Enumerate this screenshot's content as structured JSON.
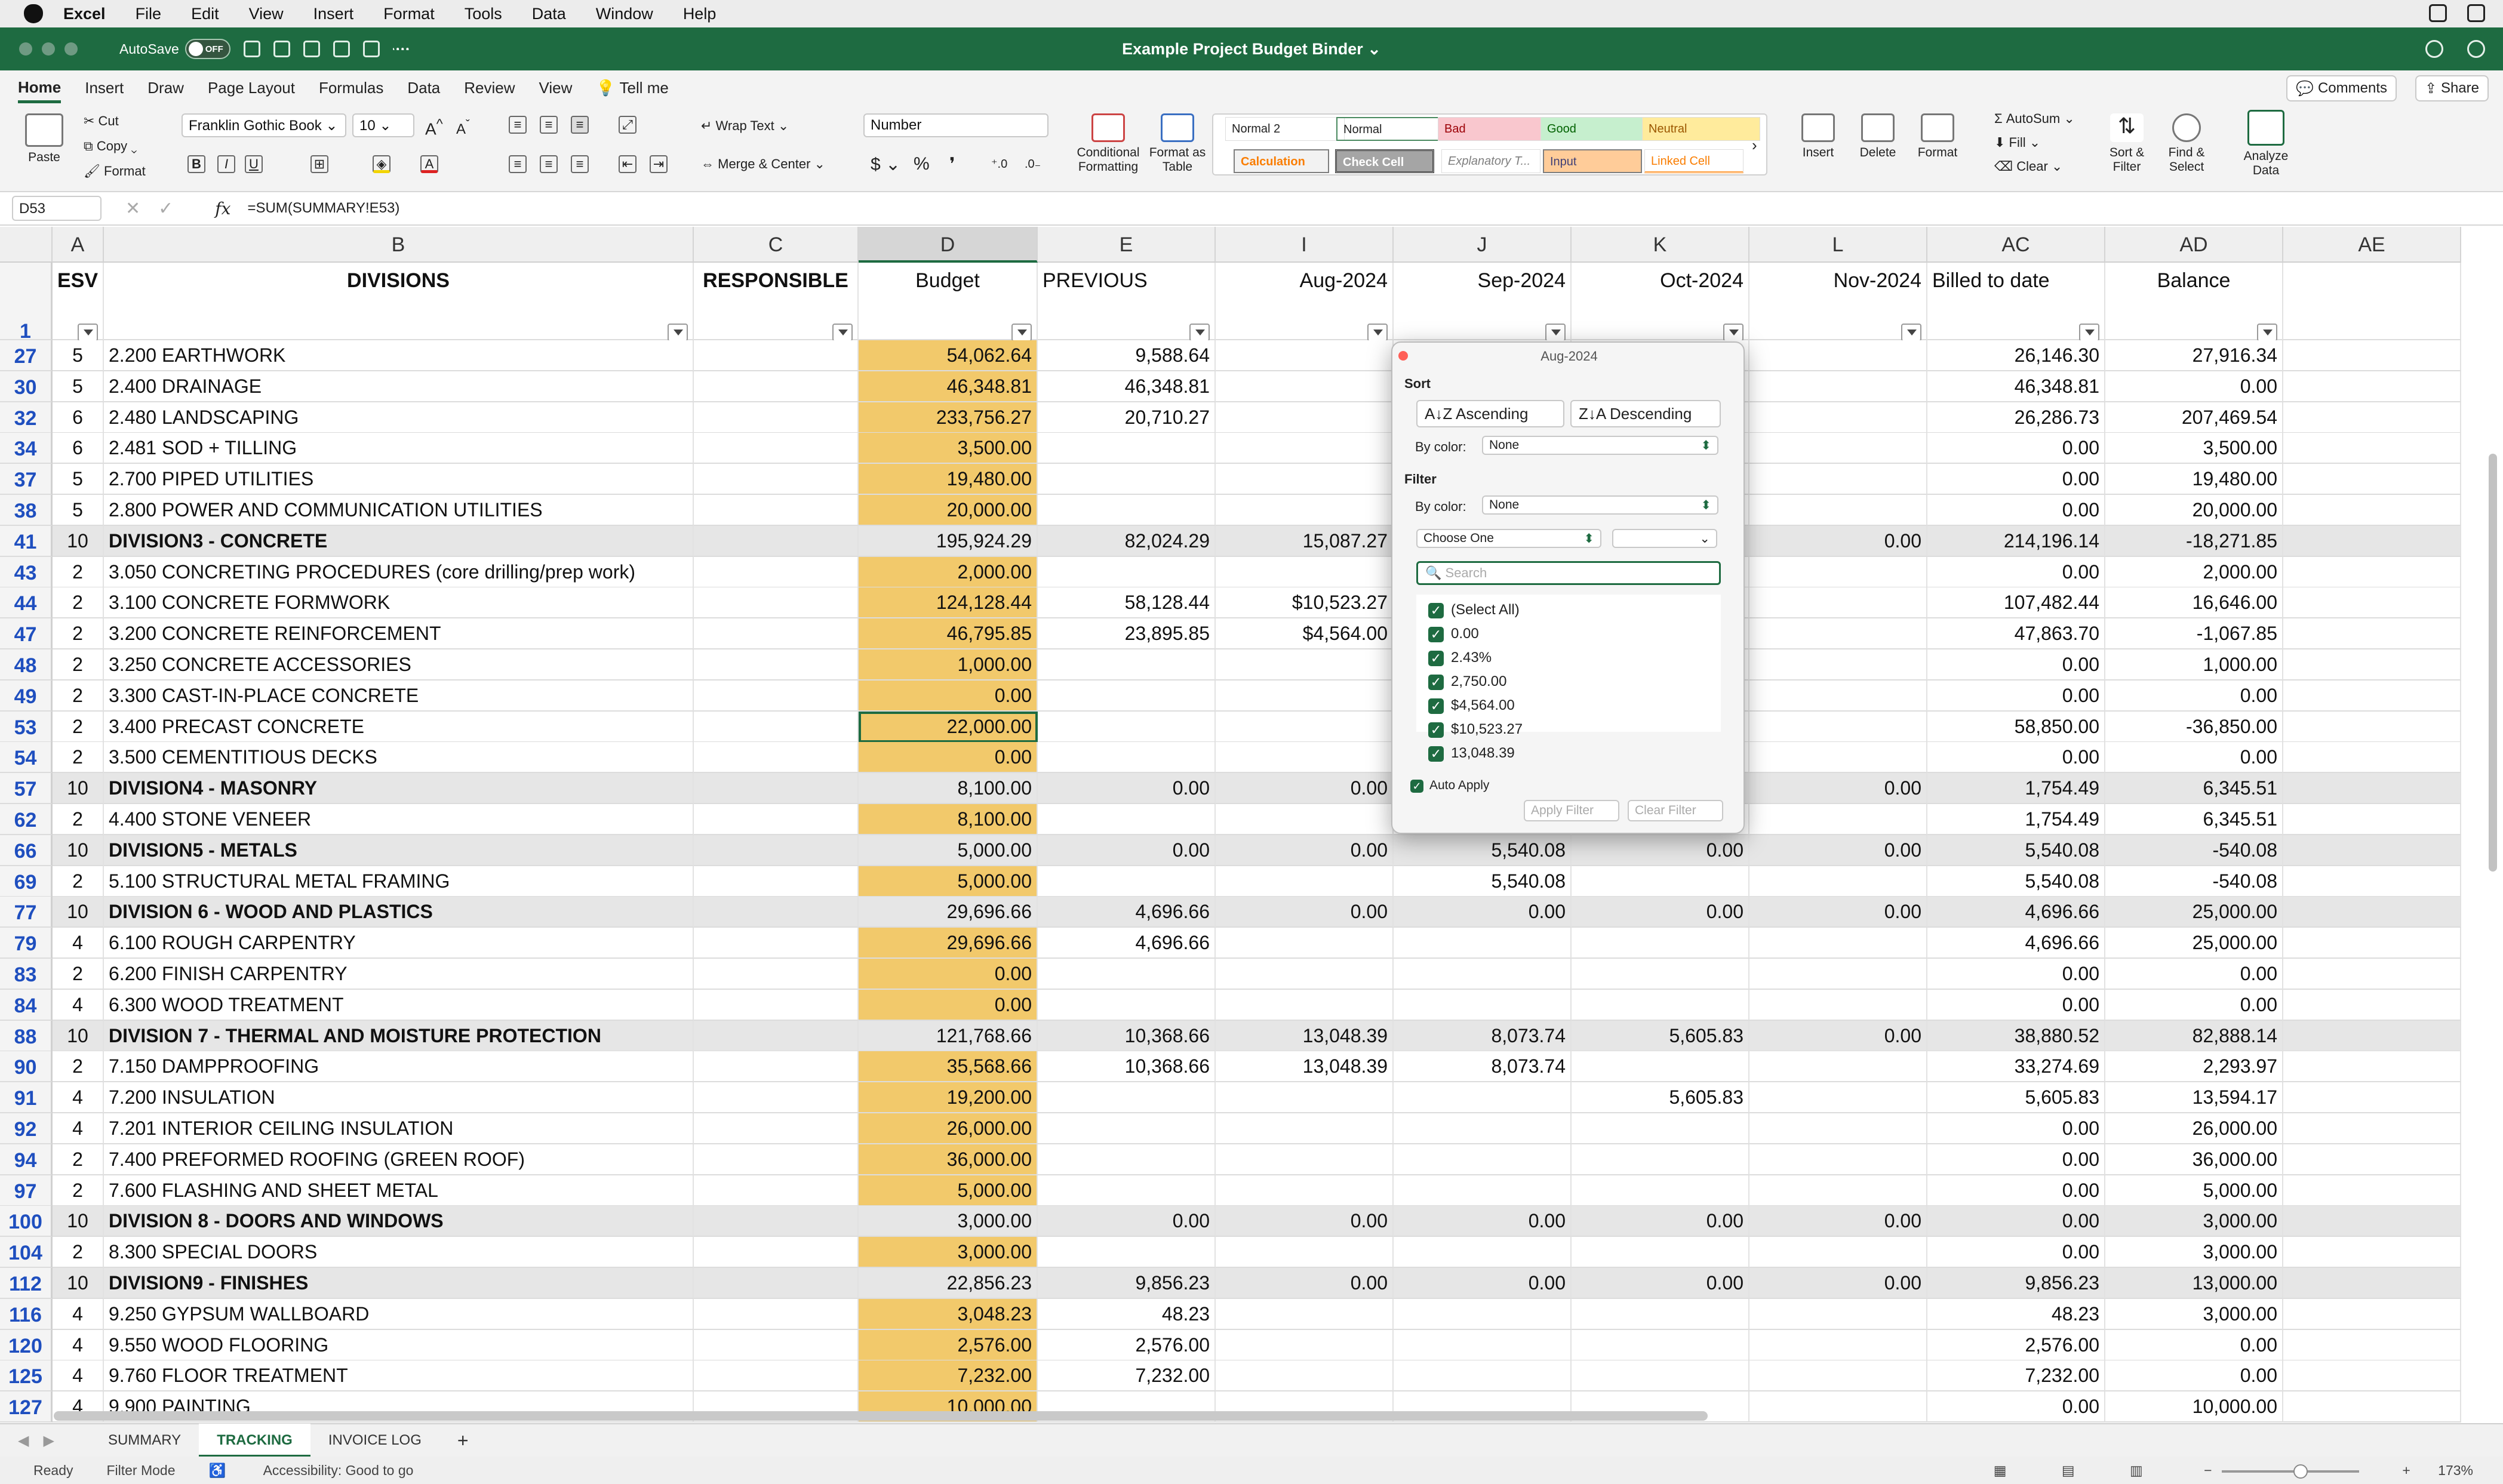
{
  "mac_menu": {
    "app": "Excel",
    "items": [
      "File",
      "Edit",
      "View",
      "Insert",
      "Format",
      "Tools",
      "Data",
      "Window",
      "Help"
    ]
  },
  "titlebar": {
    "autosave": "AutoSave",
    "toggle": "OFF",
    "title": "Example Project Budget Binder"
  },
  "tabs": [
    "Home",
    "Insert",
    "Draw",
    "Page Layout",
    "Formulas",
    "Data",
    "Review",
    "View",
    "Tell me"
  ],
  "buttons": {
    "comments": "Comments",
    "share": "Share"
  },
  "ribbon": {
    "paste": "Paste",
    "cut": "Cut",
    "copy": "Copy",
    "format": "Format",
    "font_name": "Franklin Gothic Book",
    "font_size": "10",
    "wrap_text": "Wrap Text",
    "merge_center": "Merge & Center",
    "number_format": "Number",
    "conditional_formatting": "Conditional Formatting",
    "format_as_table": "Format as Table",
    "styles": [
      "Normal 2",
      "Normal",
      "Bad",
      "Good",
      "Neutral",
      "Calculation",
      "Check Cell",
      "Explanatory T...",
      "Input",
      "Linked Cell"
    ],
    "insert": "Insert",
    "delete": "Delete",
    "format_cells": "Format",
    "autosum": "AutoSum",
    "fill": "Fill",
    "clear": "Clear",
    "sort_filter": "Sort & Filter",
    "find_select": "Find & Select",
    "analyze_data": "Analyze Data"
  },
  "formula_bar": {
    "name_box": "D53",
    "fx": "fx",
    "formula": "=SUM(SUMMARY!E53)"
  },
  "columns": [
    "A",
    "B",
    "C",
    "D",
    "E",
    "I",
    "J",
    "K",
    "L",
    "AC",
    "AD",
    "AE"
  ],
  "header_row": {
    "row": "1",
    "cells": [
      "ESV",
      "DIVISIONS",
      "RESPONSIBLE",
      "Budget",
      "PREVIOUS",
      "Aug-2024",
      "Sep-2024",
      "Oct-2024",
      "Nov-2024",
      "Billed to date",
      "Balance",
      ""
    ]
  },
  "rows": [
    {
      "r": "27",
      "a": "5",
      "b": "2.200 EARTHWORK",
      "d": "54,062.64",
      "e": "9,588.64",
      "i": "",
      "j": "",
      "k": "",
      "l": "",
      "ac": "26,146.30",
      "ad": "27,916.34",
      "div": false
    },
    {
      "r": "30",
      "a": "5",
      "b": "2.400 DRAINAGE",
      "d": "46,348.81",
      "e": "46,348.81",
      "i": "",
      "j": "",
      "k": "",
      "l": "",
      "ac": "46,348.81",
      "ad": "0.00",
      "div": false
    },
    {
      "r": "32",
      "a": "6",
      "b": "2.480 LANDSCAPING",
      "d": "233,756.27",
      "e": "20,710.27",
      "i": "",
      "j": "",
      "k": "",
      "l": "",
      "ac": "26,286.73",
      "ad": "207,469.54",
      "div": false
    },
    {
      "r": "34",
      "a": "6",
      "b": "2.481 SOD + TILLING",
      "d": "3,500.00",
      "e": "",
      "i": "",
      "j": "",
      "k": "",
      "l": "",
      "ac": "0.00",
      "ad": "3,500.00",
      "div": false
    },
    {
      "r": "37",
      "a": "5",
      "b": "2.700 PIPED UTILITIES",
      "d": "19,480.00",
      "e": "",
      "i": "",
      "j": "",
      "k": "",
      "l": "",
      "ac": "0.00",
      "ad": "19,480.00",
      "div": false
    },
    {
      "r": "38",
      "a": "5",
      "b": "2.800 POWER AND COMMUNICATION UTILITIES",
      "d": "20,000.00",
      "e": "",
      "i": "",
      "j": "",
      "k": "",
      "l": "",
      "ac": "0.00",
      "ad": "20,000.00",
      "div": false
    },
    {
      "r": "41",
      "a": "10",
      "b": "DIVISION3 - CONCRETE",
      "d": "195,924.29",
      "e": "82,024.29",
      "i": "15,087.27",
      "j": "",
      "k": "",
      "l": "0.00",
      "ac": "214,196.14",
      "ad": "-18,271.85",
      "div": true
    },
    {
      "r": "43",
      "a": "2",
      "b": "3.050 CONCRETING PROCEDURES (core drilling/prep work)",
      "d": "2,000.00",
      "e": "",
      "i": "",
      "j": "",
      "k": "",
      "l": "",
      "ac": "0.00",
      "ad": "2,000.00",
      "div": false
    },
    {
      "r": "44",
      "a": "2",
      "b": "3.100 CONCRETE FORMWORK",
      "d": "124,128.44",
      "e": "58,128.44",
      "i": "$10,523.27",
      "j": "",
      "k": "",
      "l": "",
      "ac": "107,482.44",
      "ad": "16,646.00",
      "div": false
    },
    {
      "r": "47",
      "a": "2",
      "b": "3.200 CONCRETE REINFORCEMENT",
      "d": "46,795.85",
      "e": "23,895.85",
      "i": "$4,564.00",
      "j": "",
      "k": "",
      "l": "",
      "ac": "47,863.70",
      "ad": "-1,067.85",
      "div": false
    },
    {
      "r": "48",
      "a": "2",
      "b": "3.250 CONCRETE ACCESSORIES",
      "d": "1,000.00",
      "e": "",
      "i": "",
      "j": "",
      "k": "",
      "l": "",
      "ac": "0.00",
      "ad": "1,000.00",
      "div": false
    },
    {
      "r": "49",
      "a": "2",
      "b": "3.300 CAST-IN-PLACE CONCRETE",
      "d": "0.00",
      "e": "",
      "i": "",
      "j": "",
      "k": "",
      "l": "",
      "ac": "0.00",
      "ad": "0.00",
      "div": false
    },
    {
      "r": "53",
      "a": "2",
      "b": "3.400 PRECAST CONCRETE",
      "d": "22,000.00",
      "e": "",
      "i": "",
      "j": "",
      "k": "",
      "l": "",
      "ac": "58,850.00",
      "ad": "-36,850.00",
      "div": false,
      "active": true
    },
    {
      "r": "54",
      "a": "2",
      "b": "3.500 CEMENTITIOUS DECKS",
      "d": "0.00",
      "e": "",
      "i": "",
      "j": "",
      "k": "",
      "l": "",
      "ac": "0.00",
      "ad": "0.00",
      "div": false
    },
    {
      "r": "57",
      "a": "10",
      "b": "DIVISION4 - MASONRY",
      "d": "8,100.00",
      "e": "0.00",
      "i": "0.00",
      "j": "",
      "k": "",
      "l": "0.00",
      "ac": "1,754.49",
      "ad": "6,345.51",
      "div": true
    },
    {
      "r": "62",
      "a": "2",
      "b": "4.400 STONE VENEER",
      "d": "8,100.00",
      "e": "",
      "i": "",
      "j": "",
      "k": "",
      "l": "",
      "ac": "1,754.49",
      "ad": "6,345.51",
      "div": false
    },
    {
      "r": "66",
      "a": "10",
      "b": "DIVISION5 - METALS",
      "d": "5,000.00",
      "e": "0.00",
      "i": "0.00",
      "j": "5,540.08",
      "k": "0.00",
      "l": "0.00",
      "ac": "5,540.08",
      "ad": "-540.08",
      "div": true
    },
    {
      "r": "69",
      "a": "2",
      "b": "5.100 STRUCTURAL METAL FRAMING",
      "d": "5,000.00",
      "e": "",
      "i": "",
      "j": "5,540.08",
      "k": "",
      "l": "",
      "ac": "5,540.08",
      "ad": "-540.08",
      "div": false
    },
    {
      "r": "77",
      "a": "10",
      "b": "DIVISION 6 - WOOD AND PLASTICS",
      "d": "29,696.66",
      "e": "4,696.66",
      "i": "0.00",
      "j": "0.00",
      "k": "0.00",
      "l": "0.00",
      "ac": "4,696.66",
      "ad": "25,000.00",
      "div": true
    },
    {
      "r": "79",
      "a": "4",
      "b": "6.100 ROUGH CARPENTRY",
      "d": "29,696.66",
      "e": "4,696.66",
      "i": "",
      "j": "",
      "k": "",
      "l": "",
      "ac": "4,696.66",
      "ad": "25,000.00",
      "div": false
    },
    {
      "r": "83",
      "a": "2",
      "b": "6.200 FINISH CARPENTRY",
      "d": "0.00",
      "e": "",
      "i": "",
      "j": "",
      "k": "",
      "l": "",
      "ac": "0.00",
      "ad": "0.00",
      "div": false
    },
    {
      "r": "84",
      "a": "4",
      "b": "6.300 WOOD TREATMENT",
      "d": "0.00",
      "e": "",
      "i": "",
      "j": "",
      "k": "",
      "l": "",
      "ac": "0.00",
      "ad": "0.00",
      "div": false
    },
    {
      "r": "88",
      "a": "10",
      "b": "DIVISION 7 - THERMAL AND MOISTURE PROTECTION",
      "d": "121,768.66",
      "e": "10,368.66",
      "i": "13,048.39",
      "j": "8,073.74",
      "k": "5,605.83",
      "l": "0.00",
      "ac": "38,880.52",
      "ad": "82,888.14",
      "div": true
    },
    {
      "r": "90",
      "a": "2",
      "b": "7.150 DAMPPROOFING",
      "d": "35,568.66",
      "e": "10,368.66",
      "i": "13,048.39",
      "j": "8,073.74",
      "k": "",
      "l": "",
      "ac": "33,274.69",
      "ad": "2,293.97",
      "div": false
    },
    {
      "r": "91",
      "a": "4",
      "b": "7.200 INSULATION",
      "d": "19,200.00",
      "e": "",
      "i": "",
      "j": "",
      "k": "5,605.83",
      "l": "",
      "ac": "5,605.83",
      "ad": "13,594.17",
      "div": false
    },
    {
      "r": "92",
      "a": "4",
      "b": "7.201 INTERIOR CEILING INSULATION",
      "d": "26,000.00",
      "e": "",
      "i": "",
      "j": "",
      "k": "",
      "l": "",
      "ac": "0.00",
      "ad": "26,000.00",
      "div": false
    },
    {
      "r": "94",
      "a": "2",
      "b": "7.400 PREFORMED ROOFING (GREEN ROOF)",
      "d": "36,000.00",
      "e": "",
      "i": "",
      "j": "",
      "k": "",
      "l": "",
      "ac": "0.00",
      "ad": "36,000.00",
      "div": false
    },
    {
      "r": "97",
      "a": "2",
      "b": "7.600 FLASHING AND SHEET METAL",
      "d": "5,000.00",
      "e": "",
      "i": "",
      "j": "",
      "k": "",
      "l": "",
      "ac": "0.00",
      "ad": "5,000.00",
      "div": false
    },
    {
      "r": "100",
      "a": "10",
      "b": "DIVISION 8 - DOORS AND WINDOWS",
      "d": "3,000.00",
      "e": "0.00",
      "i": "0.00",
      "j": "0.00",
      "k": "0.00",
      "l": "0.00",
      "ac": "0.00",
      "ad": "3,000.00",
      "div": true
    },
    {
      "r": "104",
      "a": "2",
      "b": "8.300 SPECIAL DOORS",
      "d": "3,000.00",
      "e": "",
      "i": "",
      "j": "",
      "k": "",
      "l": "",
      "ac": "0.00",
      "ad": "3,000.00",
      "div": false
    },
    {
      "r": "112",
      "a": "10",
      "b": "DIVISION9 - FINISHES",
      "d": "22,856.23",
      "e": "9,856.23",
      "i": "0.00",
      "j": "0.00",
      "k": "0.00",
      "l": "0.00",
      "ac": "9,856.23",
      "ad": "13,000.00",
      "div": true
    },
    {
      "r": "116",
      "a": "4",
      "b": "9.250 GYPSUM WALLBOARD",
      "d": "3,048.23",
      "e": "48.23",
      "i": "",
      "j": "",
      "k": "",
      "l": "",
      "ac": "48.23",
      "ad": "3,000.00",
      "div": false
    },
    {
      "r": "120",
      "a": "4",
      "b": "9.550 WOOD FLOORING",
      "d": "2,576.00",
      "e": "2,576.00",
      "i": "",
      "j": "",
      "k": "",
      "l": "",
      "ac": "2,576.00",
      "ad": "0.00",
      "div": false
    },
    {
      "r": "125",
      "a": "4",
      "b": "9.760 FLOOR TREATMENT",
      "d": "7,232.00",
      "e": "7,232.00",
      "i": "",
      "j": "",
      "k": "",
      "l": "",
      "ac": "7,232.00",
      "ad": "0.00",
      "div": false
    },
    {
      "r": "127",
      "a": "4",
      "b": "9.900 PAINTING",
      "d": "10,000.00",
      "e": "",
      "i": "",
      "j": "",
      "k": "",
      "l": "",
      "ac": "0.00",
      "ad": "10,000.00",
      "div": false
    }
  ],
  "popup": {
    "title": "Aug-2024",
    "sort": "Sort",
    "ascending": "Ascending",
    "descending": "Descending",
    "by_color": "By color:",
    "none": "None",
    "filter": "Filter",
    "choose_one": "Choose One",
    "search_placeholder": "Search",
    "values": [
      "(Select All)",
      "0.00",
      "2.43%",
      "2,750.00",
      "$4,564.00",
      "$10,523.27",
      "13,048.39"
    ],
    "auto_apply": "Auto Apply",
    "apply_filter": "Apply Filter",
    "clear_filter": "Clear Filter"
  },
  "sheets": [
    "SUMMARY",
    "TRACKING",
    "INVOICE LOG"
  ],
  "active_sheet": "TRACKING",
  "status": {
    "ready": "Ready",
    "mode": "Filter Mode",
    "accessibility": "Accessibility: Good to go",
    "zoom": "173%"
  },
  "colors": {
    "excel_green": "#1e6b41",
    "budget_fill": "#f2c96b",
    "division_row": "#e6e6e6",
    "row_number": "#1f4fbf"
  }
}
